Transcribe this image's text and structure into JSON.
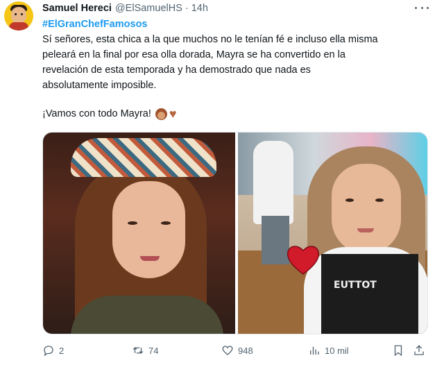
{
  "tweet": {
    "author_name": "Samuel Hereci",
    "handle": "@ElSamuelHS",
    "separator": "·",
    "time": "14h",
    "hashtag": "#ElGranChefFamosos",
    "body_lines": [
      "Sí señores, esta chica a la que muchos no le tenían fé e incluso ella misma",
      "peleará en la final por esa olla dorada, Mayra se ha convertido en la",
      "revelación de esta temporada y ha demostrado que nada es",
      "absolutamente imposible."
    ],
    "closing": "¡Vamos con todo Mayra!",
    "closing_emojis": [
      "woman-emoji",
      "brown-heart-emoji"
    ],
    "apron_logo_text": "EUTTOT"
  },
  "actions": {
    "replies": "2",
    "retweets": "74",
    "likes": "948",
    "views": "10 mil"
  },
  "colors": {
    "link": "#1d9bf0",
    "text": "#0f1419",
    "muted": "#536471"
  },
  "icons": [
    "more-icon",
    "reply-icon",
    "retweet-icon",
    "like-icon",
    "views-icon",
    "bookmark-icon",
    "share-icon"
  ]
}
